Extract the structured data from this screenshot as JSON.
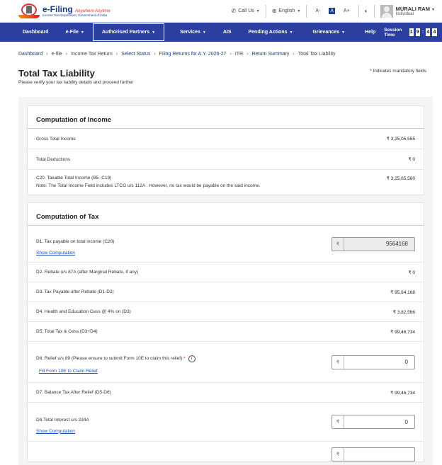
{
  "header": {
    "logo_title": "e-Filing",
    "logo_tagline": "Anywhere Anytime",
    "logo_sub": "Income Tax Department, Government of India",
    "call_us": "Call Us",
    "language": "English",
    "font_small": "A-",
    "font_normal": "A",
    "font_large": "A+",
    "user_name": "MURALI RAM",
    "user_role": "Individual"
  },
  "nav": {
    "items": [
      "Dashboard",
      "e-File",
      "Authorised Partners",
      "Services",
      "AIS",
      "Pending Actions",
      "Grievances",
      "Help"
    ],
    "session_label": "Session Time",
    "session_digits": [
      "1",
      "9",
      "4",
      "4"
    ]
  },
  "breadcrumb": [
    "Dashboard",
    "e-file",
    "Income Tax Return",
    "Select Status",
    "Filing Returns for A.Y. 2026-27",
    "ITR",
    "Return Summary",
    "Total Tax Liability"
  ],
  "page": {
    "title": "Total Tax Liability",
    "subtitle": "Please verify your tax liability details and proceed further",
    "mandatory_note": "Indicates mandatory fields"
  },
  "income": {
    "title": "Computation of Income",
    "gross_label": "Gross Total Income",
    "gross_value": "₹ 3,25,05,555",
    "deductions_label": "Total Deductions",
    "deductions_value": "₹ 0",
    "taxable_label": "C20. Taxable Total Income (B5 -C19)",
    "taxable_value": "₹ 3,25,05,560",
    "taxable_note": "Note: The Total Income Field includes LTCG u/s 112A . However, no tax would be payable on the said income."
  },
  "tax": {
    "title": "Computation of Tax",
    "d1_label": "D1. Tax payable on total income (C20)",
    "d1_value": "9564168",
    "show_computation": "Show Computation",
    "d2_label": "D2. Rebate u/s 87A (after Marginal Rebate, if any)",
    "d2_value": "₹ 0",
    "d3_label": "D3. Tax Payable after Rebate (D1-D2)",
    "d3_value": "₹ 95,64,168",
    "d4_label": "D4. Health and Education Cess @ 4% on (D3)",
    "d4_value": "₹ 3,82,566",
    "d5_label": "D5. Total Tax & Cess (D3+D4)",
    "d5_value": "₹ 99,46,734",
    "d6_label": "D6. Relief u/s 89 (Please ensure to submit Form 10E to claim this relief)",
    "d6_value": "0",
    "fill_form_link": "Fill Form 10E to Claim Relief",
    "d7_label": "D7. Balance Tax After Relief (D5-D6)",
    "d7_value": "₹ 99,46,734",
    "d8_label": "D8.Total Interest u/s 234A",
    "d8_value": "0",
    "show_computation_2": "Show Computation",
    "currency_symbol": "₹"
  }
}
